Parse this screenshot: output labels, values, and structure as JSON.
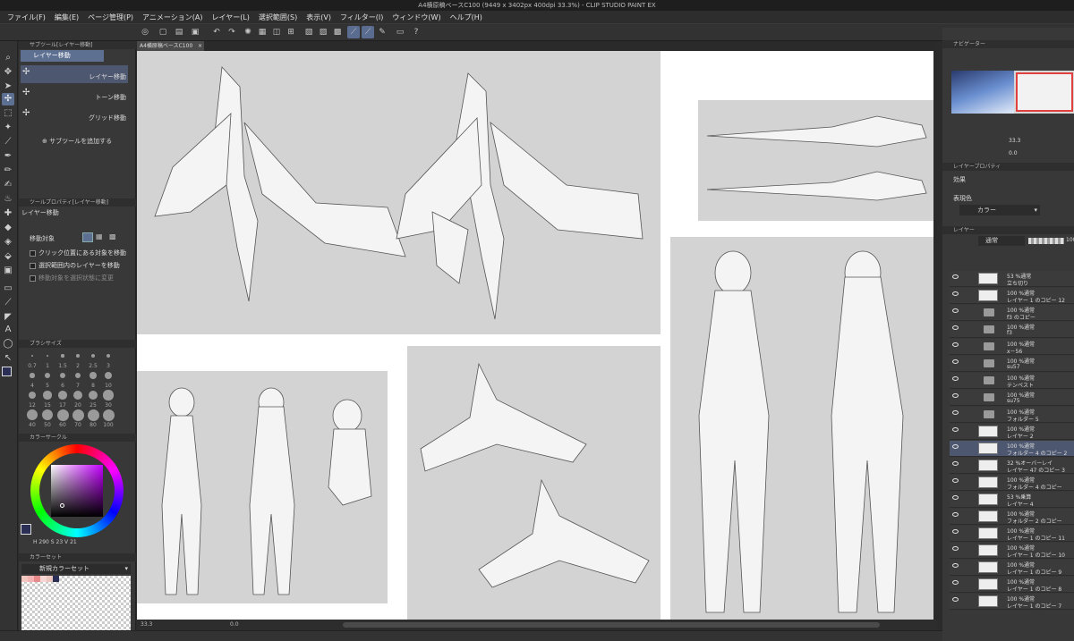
{
  "window": {
    "title": "A4横原稿ベースC100 (9449 x 3402px 400dpi 33.3%) - CLIP STUDIO PAINT EX"
  },
  "menu": [
    "ファイル(F)",
    "編集(E)",
    "ページ管理(P)",
    "アニメーション(A)",
    "レイヤー(L)",
    "選択範囲(S)",
    "表示(V)",
    "フィルター(I)",
    "ウィンドウ(W)",
    "ヘルプ(H)"
  ],
  "document_tab": {
    "label": "A4横原稿ベースC100"
  },
  "subtool_panel": {
    "tab_label": "サブツール[レイヤー移動]",
    "header": "レイヤー移動",
    "items": [
      "レイヤー移動",
      "トーン移動",
      "グリッド移動"
    ],
    "add_label": "サブツールを追加する"
  },
  "tool_property": {
    "tab_label": "ツールプロパティ[レイヤー移動]",
    "title": "レイヤー移動",
    "target_label": "移動対象",
    "checks": [
      "クリック位置にある対象を移動",
      "選択範囲内のレイヤーを移動",
      "移動対象を選択状態に変更"
    ]
  },
  "brush_size": {
    "tab_label": "ブラシサイズ",
    "sizes": [
      "0.7",
      "1",
      "1.5",
      "2",
      "2.5",
      "3",
      "4",
      "5",
      "6",
      "7",
      "8",
      "10",
      "12",
      "15",
      "17",
      "20",
      "25",
      "30",
      "40",
      "50",
      "60",
      "70",
      "80",
      "100"
    ]
  },
  "color_wheel": {
    "tab_label": "カラーサークル",
    "values": [
      "290",
      "23",
      "21"
    ]
  },
  "color_set": {
    "tab_label": "カラーセット",
    "name": "新規カラーセット"
  },
  "navigator": {
    "tab_label": "ナビゲーター",
    "zoom": "33.3",
    "angle": "0.0"
  },
  "layer_property": {
    "tab_label": "レイヤープロパティ",
    "effect_label": "効果",
    "color_label": "表現色",
    "color_value": "カラー"
  },
  "layer_panel": {
    "tab_label": "レイヤー",
    "blend_mode": "通常",
    "opacity": "100",
    "layers": [
      {
        "mode": "53 %通常",
        "name": "立ち切り",
        "type": "layer"
      },
      {
        "mode": "100 %通常",
        "name": "レイヤー 1 のコピー 12",
        "type": "layer"
      },
      {
        "mode": "100 %通常",
        "name": "f3 のコピー",
        "type": "folder"
      },
      {
        "mode": "100 %通常",
        "name": "f3",
        "type": "folder"
      },
      {
        "mode": "100 %通常",
        "name": "x－56",
        "type": "folder"
      },
      {
        "mode": "100 %通常",
        "name": "su57",
        "type": "folder"
      },
      {
        "mode": "100 %通常",
        "name": "テンペスト",
        "type": "folder"
      },
      {
        "mode": "100 %通常",
        "name": "su75",
        "type": "folder"
      },
      {
        "mode": "100 %通常",
        "name": "フォルダー 5",
        "type": "folder"
      },
      {
        "mode": "100 %通常",
        "name": "レイヤー 2",
        "type": "layer"
      },
      {
        "mode": "100 %通常",
        "name": "フォルダー 4 のコピー 2",
        "type": "layer",
        "selected": true
      },
      {
        "mode": "32 %オーバーレイ",
        "name": "レイヤー 47 のコピー 3",
        "type": "layer"
      },
      {
        "mode": "100 %通常",
        "name": "フォルダー 4 のコピー",
        "type": "layer"
      },
      {
        "mode": "53 %乗算",
        "name": "レイヤー 4",
        "type": "layer"
      },
      {
        "mode": "100 %通常",
        "name": "フォルダー 2 のコピー",
        "type": "layer"
      },
      {
        "mode": "100 %通常",
        "name": "レイヤー 1 のコピー 11",
        "type": "layer"
      },
      {
        "mode": "100 %通常",
        "name": "レイヤー 1 のコピー 10",
        "type": "layer"
      },
      {
        "mode": "100 %通常",
        "name": "レイヤー 1 のコピー 9",
        "type": "layer"
      },
      {
        "mode": "100 %通常",
        "name": "レイヤー 1 のコピー 8",
        "type": "layer"
      },
      {
        "mode": "100 %通常",
        "name": "レイヤー 1 のコピー 7",
        "type": "layer"
      }
    ]
  },
  "status": {
    "zoom": "33.3",
    "angle": "0.0"
  },
  "colors": {
    "accent": "#5e7092",
    "selected_layer": "#4d5870",
    "canvas_frame": "#d3d3d3",
    "paper": "#ffffff"
  }
}
